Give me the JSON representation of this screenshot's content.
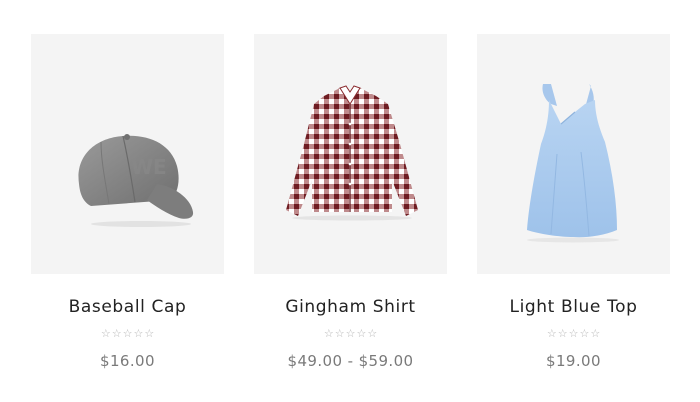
{
  "products": [
    {
      "title": "Baseball Cap",
      "price": "$16.00",
      "rating": 0,
      "rating_max": 5,
      "image_icon": "baseball-cap-image",
      "image_color": "#8b8b8b"
    },
    {
      "title": "Gingham Shirt",
      "price": "$49.00 - $59.00",
      "rating": 0,
      "rating_max": 5,
      "image_icon": "gingham-shirt-image",
      "image_color": "#8a2a2e"
    },
    {
      "title": "Light Blue Top",
      "price": "$19.00",
      "rating": 0,
      "rating_max": 5,
      "image_icon": "light-blue-top-image",
      "image_color": "#a9c9ee"
    }
  ],
  "colors": {
    "image_background": "#f4f4f4",
    "title_text": "#222222",
    "price_text": "#7a7a7a",
    "star_empty": "#b5b5b5"
  }
}
